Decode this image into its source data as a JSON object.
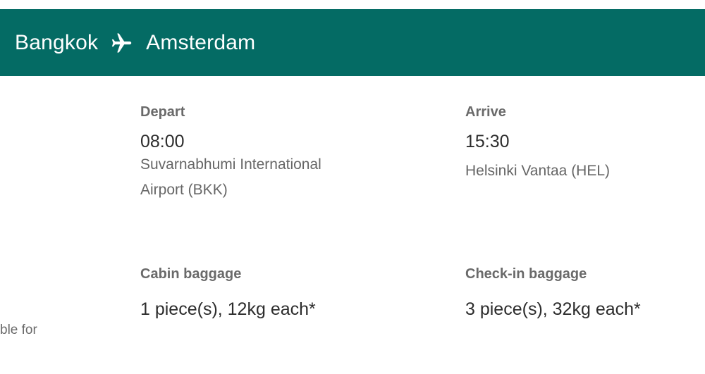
{
  "route": {
    "origin": "Bangkok",
    "destination": "Amsterdam",
    "icon": "airplane-icon",
    "header_color": "#046b64"
  },
  "depart": {
    "label": "Depart",
    "time": "08:00",
    "airport_line1": "Suvarnabhumi International",
    "airport_line2": "Airport (BKK)"
  },
  "arrive": {
    "label": "Arrive",
    "time": "15:30",
    "airport": "Helsinki Vantaa (HEL)"
  },
  "cabin_baggage": {
    "label": "Cabin baggage",
    "value": "1 piece(s), 12kg each*"
  },
  "checkin_baggage": {
    "label": "Check-in baggage",
    "value": "3 piece(s), 32kg each*"
  },
  "side_text": "ble for"
}
